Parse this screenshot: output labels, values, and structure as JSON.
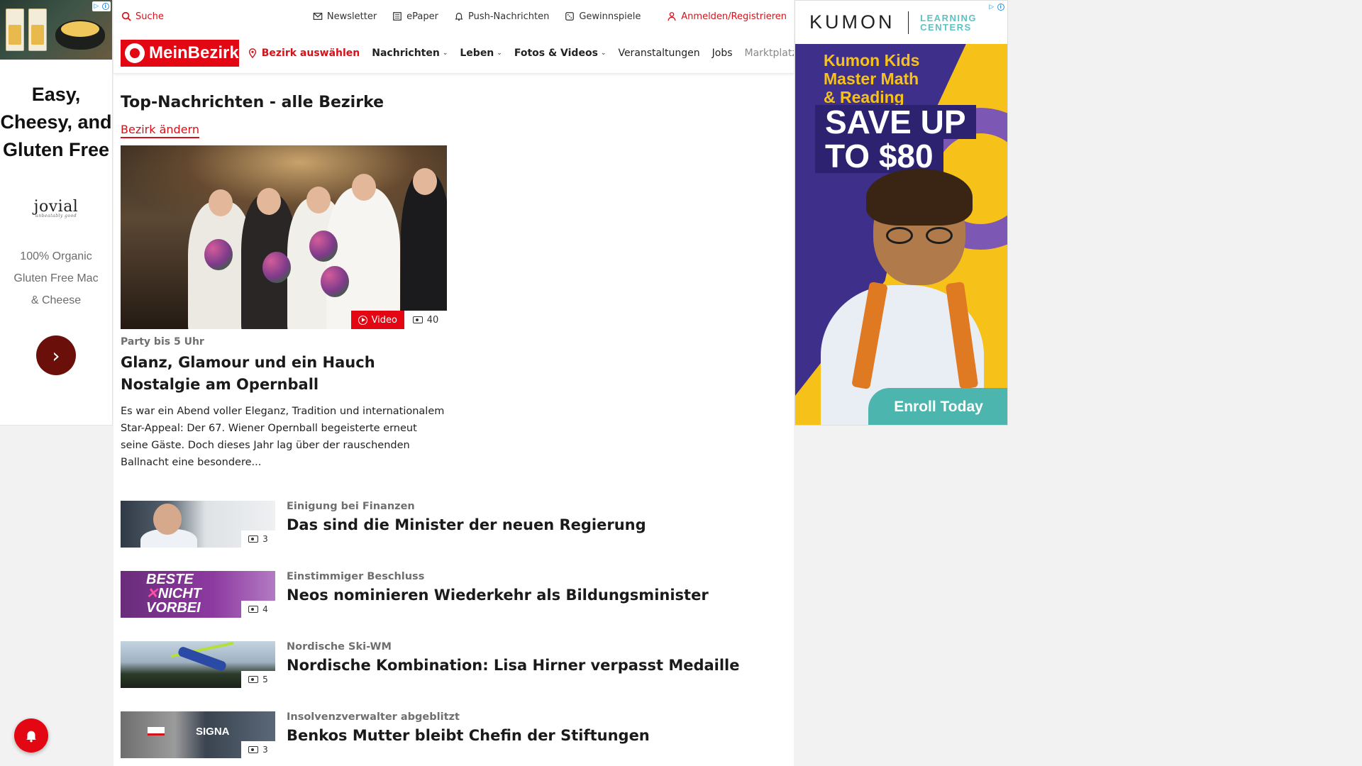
{
  "left_ad": {
    "headline": "Easy, Cheesy, and Gluten Free",
    "brand": "jovial",
    "brand_tagline": "unbeatably good",
    "description": "100% Organic Gluten Free Mac & Cheese",
    "cta_icon": "chevron-right-icon"
  },
  "header": {
    "search_label": "Suche",
    "links": [
      {
        "label": "Newsletter",
        "icon": "envelope-icon"
      },
      {
        "label": "ePaper",
        "icon": "newspaper-icon"
      },
      {
        "label": "Push-Nachrichten",
        "icon": "bell-icon"
      },
      {
        "label": "Gewinnspiele",
        "icon": "dice-icon"
      }
    ],
    "login_label": "Anmelden/Registrieren"
  },
  "nav": {
    "logo_text": "MeinBezirk",
    "bezirk_label": "Bezirk auswählen",
    "items": [
      {
        "label": "Nachrichten",
        "dropdown": true
      },
      {
        "label": "Leben",
        "dropdown": true
      },
      {
        "label": "Fotos & Videos",
        "dropdown": true
      },
      {
        "label": "Veranstaltungen",
        "dropdown": false
      },
      {
        "label": "Jobs",
        "dropdown": false
      },
      {
        "label": "Marktplatz",
        "dropdown": false
      }
    ]
  },
  "main": {
    "section_title": "Top-Nachrichten - alle Bezirke",
    "change_bezirk": "Bezirk ändern",
    "hero": {
      "video_label": "Video",
      "photo_count": "40",
      "kicker": "Party bis 5 Uhr",
      "title": "Glanz, Glamour und ein Hauch Nostalgie am Opernball",
      "teaser": "Es war ein Abend voller Eleganz, Tradition und internationalem Star-Appeal: Der 67. Wiener Opernball begeisterte erneut seine Gäste. Doch dieses Jahr lag über der rauschenden Ballnacht eine besondere..."
    },
    "articles": [
      {
        "kicker": "Einigung bei Finanzen",
        "title": "Das sind die Minister der neuen Regierung",
        "photo_count": "3"
      },
      {
        "kicker": "Einstimmiger Beschluss",
        "title": "Neos nominieren Wiederkehr als Bildungsminister",
        "photo_count": "4"
      },
      {
        "kicker": "Nordische Ski-WM",
        "title": "Nordische Kombination: Lisa Hirner verpasst Medaille",
        "photo_count": "5"
      },
      {
        "kicker": "Insolvenzverwalter abgeblitzt",
        "title": "Benkos Mutter bleibt Chefin der Stiftungen",
        "photo_count": "3"
      }
    ]
  },
  "right_ad": {
    "brand": "KUMON",
    "brand_sub": "LEARNING CENTERS",
    "tagline_lines": [
      "Kumon Kids",
      "Master Math",
      "& Reading"
    ],
    "offer_line1": "SAVE UP",
    "offer_line2": "TO $80",
    "cta": "Enroll Today"
  },
  "thumb_texts": {
    "neos_line1": "BESTE",
    "neos_line2": "NICHT",
    "neos_line3": "VORBEI",
    "signa": "SIGNA"
  },
  "floating": {
    "notify_icon": "bell-icon"
  },
  "colors": {
    "brand_red": "#e30613",
    "kumon_purple": "#3d2f8a",
    "kumon_yellow": "#f6c21a",
    "kumon_teal": "#4bb5ae"
  }
}
